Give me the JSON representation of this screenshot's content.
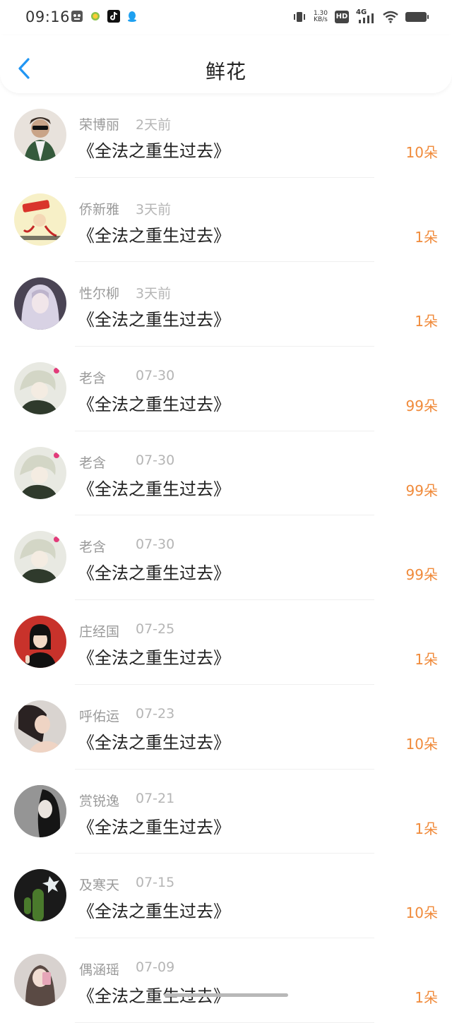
{
  "status_bar": {
    "time": "09:16",
    "net_speed_value": "1.30",
    "net_speed_unit": "KB/s",
    "hd_label": "HD",
    "network_label": "4G"
  },
  "header": {
    "title": "鲜花"
  },
  "items": [
    {
      "name": "荣博丽",
      "time": "2天前",
      "book": "《全法之重生过去》",
      "count": "10朵",
      "avatar_color": "#e8e2dc"
    },
    {
      "name": "侨新雅",
      "time": "3天前",
      "book": "《全法之重生过去》",
      "count": "1朵",
      "avatar_color": "#f7f0c7"
    },
    {
      "name": "性尔柳",
      "time": "3天前",
      "book": "《全法之重生过去》",
      "count": "1朵",
      "avatar_color": "#4a4454"
    },
    {
      "name": "老含",
      "time": "07-30",
      "book": "《全法之重生过去》",
      "count": "99朵",
      "avatar_color": "#e8e9e2"
    },
    {
      "name": "老含",
      "time": "07-30",
      "book": "《全法之重生过去》",
      "count": "99朵",
      "avatar_color": "#e8e9e2"
    },
    {
      "name": "老含",
      "time": "07-30",
      "book": "《全法之重生过去》",
      "count": "99朵",
      "avatar_color": "#e8e9e2"
    },
    {
      "name": "庄经国",
      "time": "07-25",
      "book": "《全法之重生过去》",
      "count": "1朵",
      "avatar_color": "#c8322b"
    },
    {
      "name": "呼佑运",
      "time": "07-23",
      "book": "《全法之重生过去》",
      "count": "10朵",
      "avatar_color": "#d9d4d0"
    },
    {
      "name": "赏锐逸",
      "time": "07-21",
      "book": "《全法之重生过去》",
      "count": "1朵",
      "avatar_color": "#5a5a5a"
    },
    {
      "name": "及寒天",
      "time": "07-15",
      "book": "《全法之重生过去》",
      "count": "10朵",
      "avatar_color": "#1a1a1a"
    },
    {
      "name": "偶涵瑶",
      "time": "07-09",
      "book": "《全法之重生过去》",
      "count": "1朵",
      "avatar_color": "#d8d2cf"
    }
  ]
}
